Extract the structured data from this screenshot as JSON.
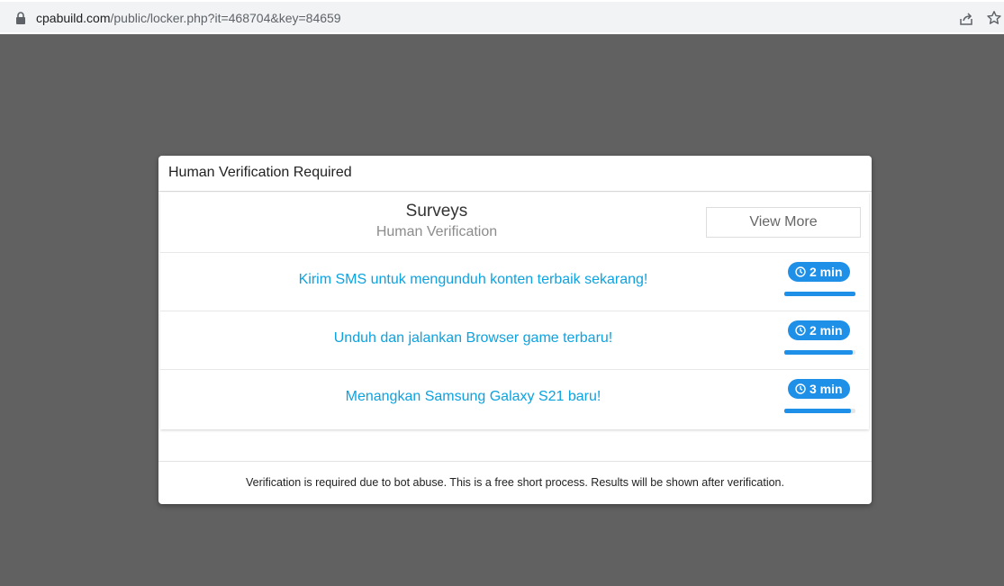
{
  "browser": {
    "url_host": "cpabuild.com",
    "url_path": "/public/locker.php?it=468704&key=84659",
    "icons": {
      "lock": "lock-icon",
      "share": "share-icon",
      "bookmark": "star-icon"
    }
  },
  "dialog": {
    "title": "Human Verification Required",
    "section_title": "Surveys",
    "section_subtitle": "Human Verification",
    "view_more_label": "View More",
    "offers": [
      {
        "text": "Kirim SMS untuk mengunduh konten terbaik sekarang!",
        "time": "2 min",
        "progress": 1.0
      },
      {
        "text": "Unduh dan jalankan Browser game terbaru!",
        "time": "2 min",
        "progress": 0.96
      },
      {
        "text": "Menangkan Samsung Galaxy S21 baru!",
        "time": "3 min",
        "progress": 0.94
      }
    ],
    "footer_text": "Verification is required due to bot abuse. This is a free short process. Results will be shown after verification."
  },
  "colors": {
    "backdrop": "#616161",
    "link": "#0da2e0",
    "badge": "#1e90e8"
  }
}
